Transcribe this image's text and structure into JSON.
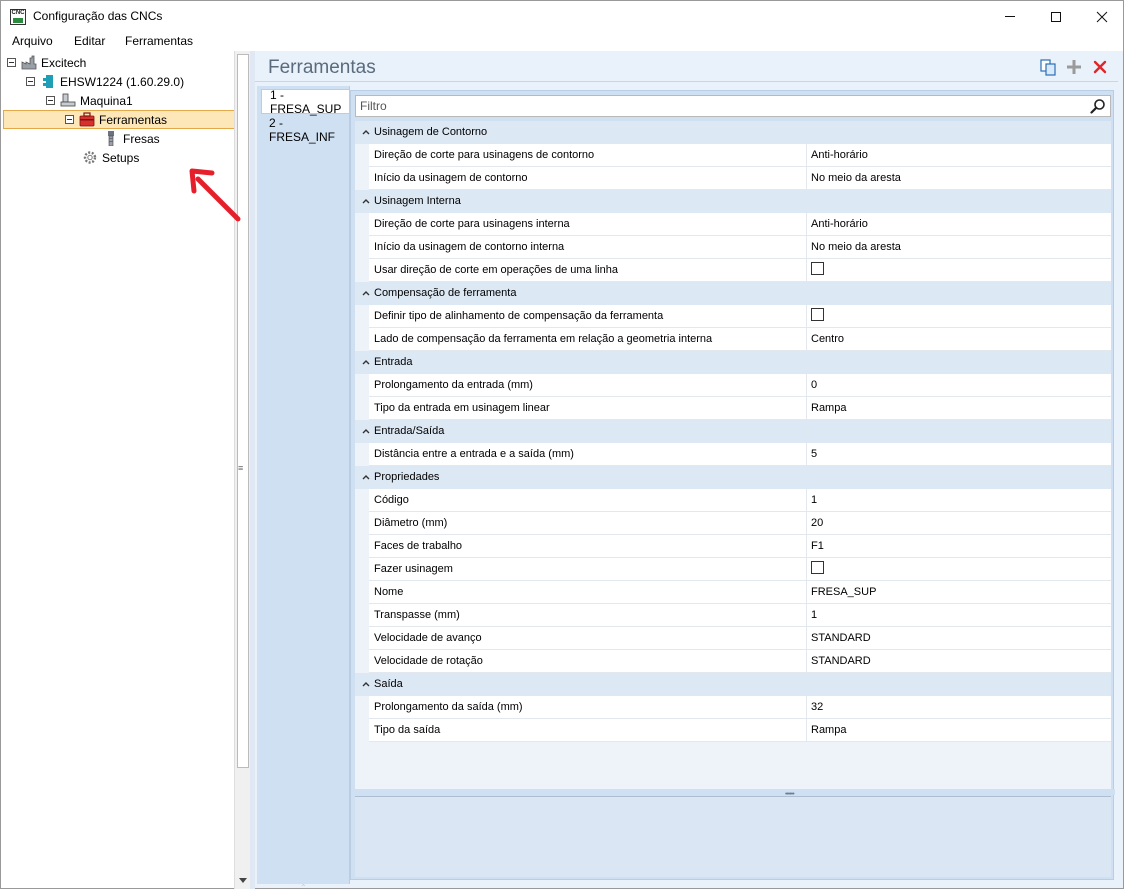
{
  "window": {
    "title": "Configuração das CNCs",
    "app_icon_text": "CNC"
  },
  "menu": {
    "items": [
      "Arquivo",
      "Editar",
      "Ferramentas"
    ]
  },
  "tree": {
    "nodes": [
      {
        "label": "Excitech",
        "icon": "factory-icon"
      },
      {
        "label": "EHSW1224 (1.60.29.0)",
        "icon": "machine-module-icon"
      },
      {
        "label": "Maquina1",
        "icon": "machine-icon"
      },
      {
        "label": "Ferramentas",
        "icon": "toolbox-icon",
        "selected": true
      },
      {
        "label": "Fresas",
        "icon": "drill-bit-icon"
      },
      {
        "label": "Setups",
        "icon": "gear-icon"
      }
    ]
  },
  "panel": {
    "title": "Ferramentas",
    "toolbar": [
      "copy-icon",
      "add-icon",
      "delete-icon"
    ]
  },
  "tabs": [
    {
      "label": "1 - FRESA_SUP",
      "active": true
    },
    {
      "label": "2 - FRESA_INF",
      "active": false
    }
  ],
  "filter": {
    "placeholder": "Filtro"
  },
  "grid": {
    "categories": [
      {
        "label": "Usinagem de Contorno",
        "properties": [
          {
            "name": "Direção de corte para usinagens de contorno",
            "value": "Anti-horário"
          },
          {
            "name": "Início da usinagem de contorno",
            "value": "No meio da aresta"
          }
        ]
      },
      {
        "label": "Usinagem Interna",
        "properties": [
          {
            "name": "Direção de corte para usinagens interna",
            "value": "Anti-horário"
          },
          {
            "name": "Início da usinagem de contorno interna",
            "value": "No meio da aresta"
          },
          {
            "name": "Usar direção de corte em operações de uma linha",
            "value": "",
            "checkbox": true,
            "checked": false
          }
        ]
      },
      {
        "label": "Compensação de ferramenta",
        "properties": [
          {
            "name": "Definir tipo de alinhamento de compensação da ferramenta",
            "value": "",
            "checkbox": true,
            "checked": false
          },
          {
            "name": "Lado de compensação da ferramenta em relação a geometria interna",
            "value": "Centro"
          }
        ]
      },
      {
        "label": "Entrada",
        "properties": [
          {
            "name": "Prolongamento da entrada (mm)",
            "value": "0"
          },
          {
            "name": "Tipo da entrada em usinagem linear",
            "value": "Rampa"
          }
        ]
      },
      {
        "label": "Entrada/Saída",
        "properties": [
          {
            "name": "Distância entre a entrada e a saída (mm)",
            "value": "5"
          }
        ]
      },
      {
        "label": "Propriedades",
        "properties": [
          {
            "name": "Código",
            "value": "1"
          },
          {
            "name": "Diâmetro (mm)",
            "value": "20"
          },
          {
            "name": "Faces de trabalho",
            "value": "F1"
          },
          {
            "name": "Fazer usinagem",
            "value": "",
            "checkbox": true,
            "checked": false
          },
          {
            "name": "Nome",
            "value": "FRESA_SUP"
          },
          {
            "name": "Transpasse (mm)",
            "value": "1"
          },
          {
            "name": "Velocidade de avanço",
            "value": "STANDARD"
          },
          {
            "name": "Velocidade de rotação",
            "value": "STANDARD"
          }
        ]
      },
      {
        "label": "Saída",
        "properties": [
          {
            "name": "Prolongamento da saída (mm)",
            "value": "32"
          },
          {
            "name": "Tipo da saída",
            "value": "Rampa"
          }
        ]
      }
    ]
  },
  "colors": {
    "accent": "#e4a84a",
    "selection": "#fde6b8",
    "panel_bg": "#e9f1fa",
    "annotation": "#e5202a"
  }
}
